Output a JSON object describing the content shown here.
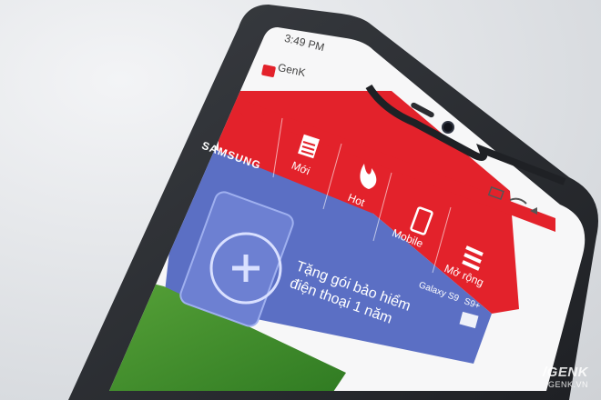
{
  "status_bar": {
    "time": "3:49 PM"
  },
  "app": {
    "name": "GenK",
    "brand_color": "#e3222b"
  },
  "nav_tabs": [
    {
      "label": "Mới",
      "icon": "document-icon"
    },
    {
      "label": "Hot",
      "icon": "flame-icon"
    },
    {
      "label": "Mobile",
      "icon": "smartphone-icon"
    },
    {
      "label": "Mở rộng",
      "icon": "menu-icon"
    }
  ],
  "ad_banner": {
    "brand": "SAMSUNG",
    "headline_line1": "Tặng gói bảo hiểm",
    "headline_line2": "điện thoại 1 năm",
    "product": "Galaxy S9",
    "product_suffix": "S9+",
    "bg_color": "#5b6fc4"
  },
  "watermark": {
    "brand": "/GENK",
    "domain": "GENK.VN"
  }
}
